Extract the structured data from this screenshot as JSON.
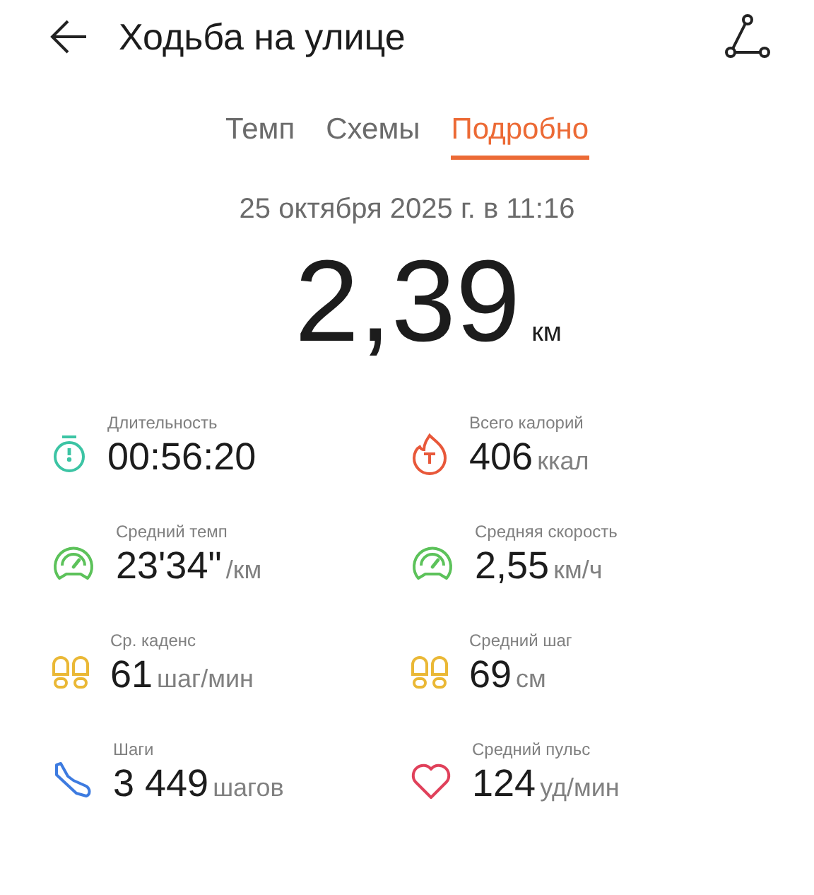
{
  "header": {
    "title": "Ходьба на улице"
  },
  "tabs": [
    {
      "label": "Темп",
      "selected": false
    },
    {
      "label": "Схемы",
      "selected": false
    },
    {
      "label": "Подробно",
      "selected": true
    }
  ],
  "date": "25 октября 2025 г. в 11:16",
  "distance": {
    "value": "2,39",
    "unit": "км"
  },
  "stats": [
    {
      "kind": "stopwatch",
      "label": "Длительность",
      "value": "00:56:20"
    },
    {
      "kind": "flame",
      "label": "Всего калорий",
      "value": "406",
      "unit": "ккал"
    },
    {
      "kind": "gauge",
      "label": "Средний темп",
      "value": "23'34\"",
      "unit": "/км"
    },
    {
      "kind": "gauge",
      "label": "Средняя скорость",
      "value": "2,55",
      "unit": "км/ч"
    },
    {
      "kind": "footprints",
      "label": "Ср. каденс",
      "value": "61",
      "unit": "шаг/мин"
    },
    {
      "kind": "footprints",
      "label": "Средний шаг",
      "value": "69",
      "unit": "см"
    },
    {
      "kind": "shoe",
      "label": "Шаги",
      "value": "3 449",
      "unit": "шагов"
    },
    {
      "kind": "heart",
      "label": "Средний пульс",
      "value": "124",
      "unit": "уд/мин"
    }
  ]
}
